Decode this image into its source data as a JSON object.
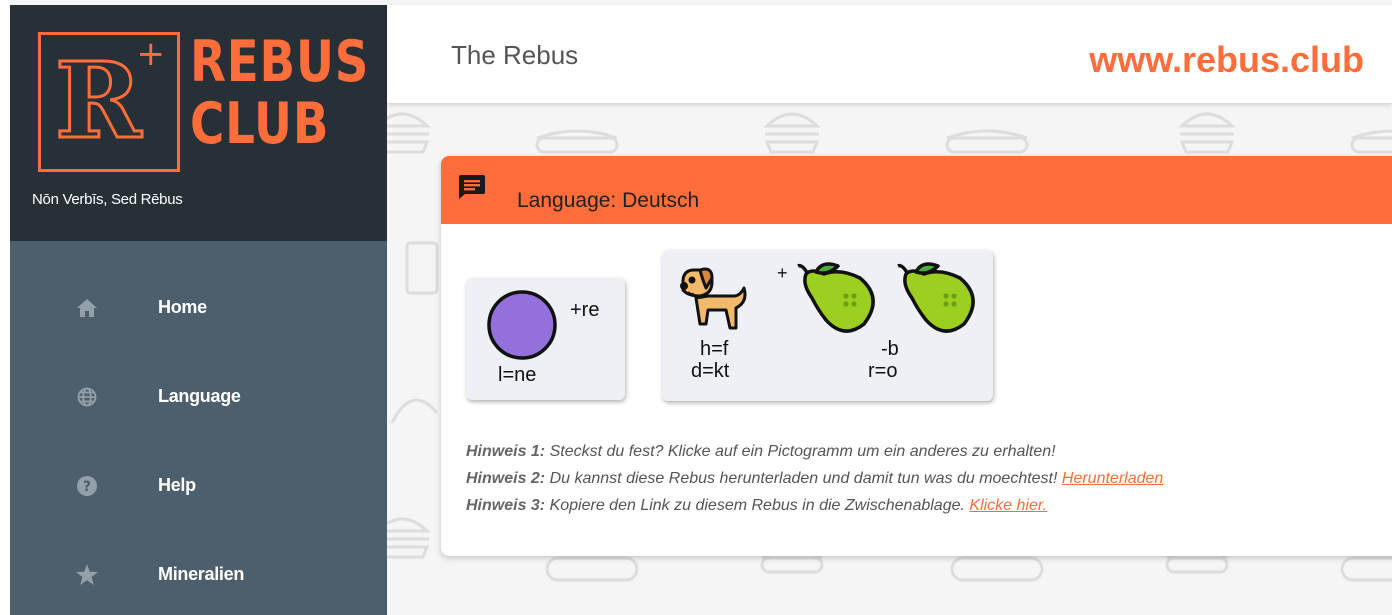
{
  "brand": {
    "logo_letter": "R",
    "logo_plus": "+",
    "logo_line1": "REBUS",
    "logo_line2": "CLUB",
    "tagline": "Nōn Verbīs, Sed Rēbus"
  },
  "nav": {
    "items": [
      {
        "label": "Home",
        "icon": "home-icon"
      },
      {
        "label": "Language",
        "icon": "globe-icon"
      },
      {
        "label": "Help",
        "icon": "help-icon"
      },
      {
        "label": "Mineralien",
        "icon": "star-icon"
      }
    ]
  },
  "header": {
    "title": "The Rebus",
    "site_url": "www.rebus.club"
  },
  "card": {
    "title": "Language: Deutsch",
    "tiles": [
      {
        "picture": "circle",
        "top_right": "+re",
        "bottom": "l=ne"
      },
      {
        "picture": "dog + pear + pear",
        "plus": "+",
        "dog_sub1": "h=f",
        "dog_sub2": "d=kt",
        "pear_sub1": "-b",
        "pear_sub2": "r=o"
      }
    ],
    "hints": [
      {
        "label": "Hinweis 1:",
        "text": " Steckst du fest? Klicke auf ein Pictogramm um ein anderes zu erhalten!",
        "link": ""
      },
      {
        "label": "Hinweis 2:",
        "text": " Du kannst diese Rebus herunterladen und damit tun was du moechtest! ",
        "link": "Herunterladen"
      },
      {
        "label": "Hinweis 3:",
        "text": " Kopiere den Link zu diesem Rebus in die Zwischenablage. ",
        "link": "Klicke hier."
      }
    ]
  },
  "colors": {
    "accent": "#ff6d3a",
    "sidebar_dark": "#273037",
    "sidebar": "#4d5f6c",
    "circle": "#9370db"
  }
}
